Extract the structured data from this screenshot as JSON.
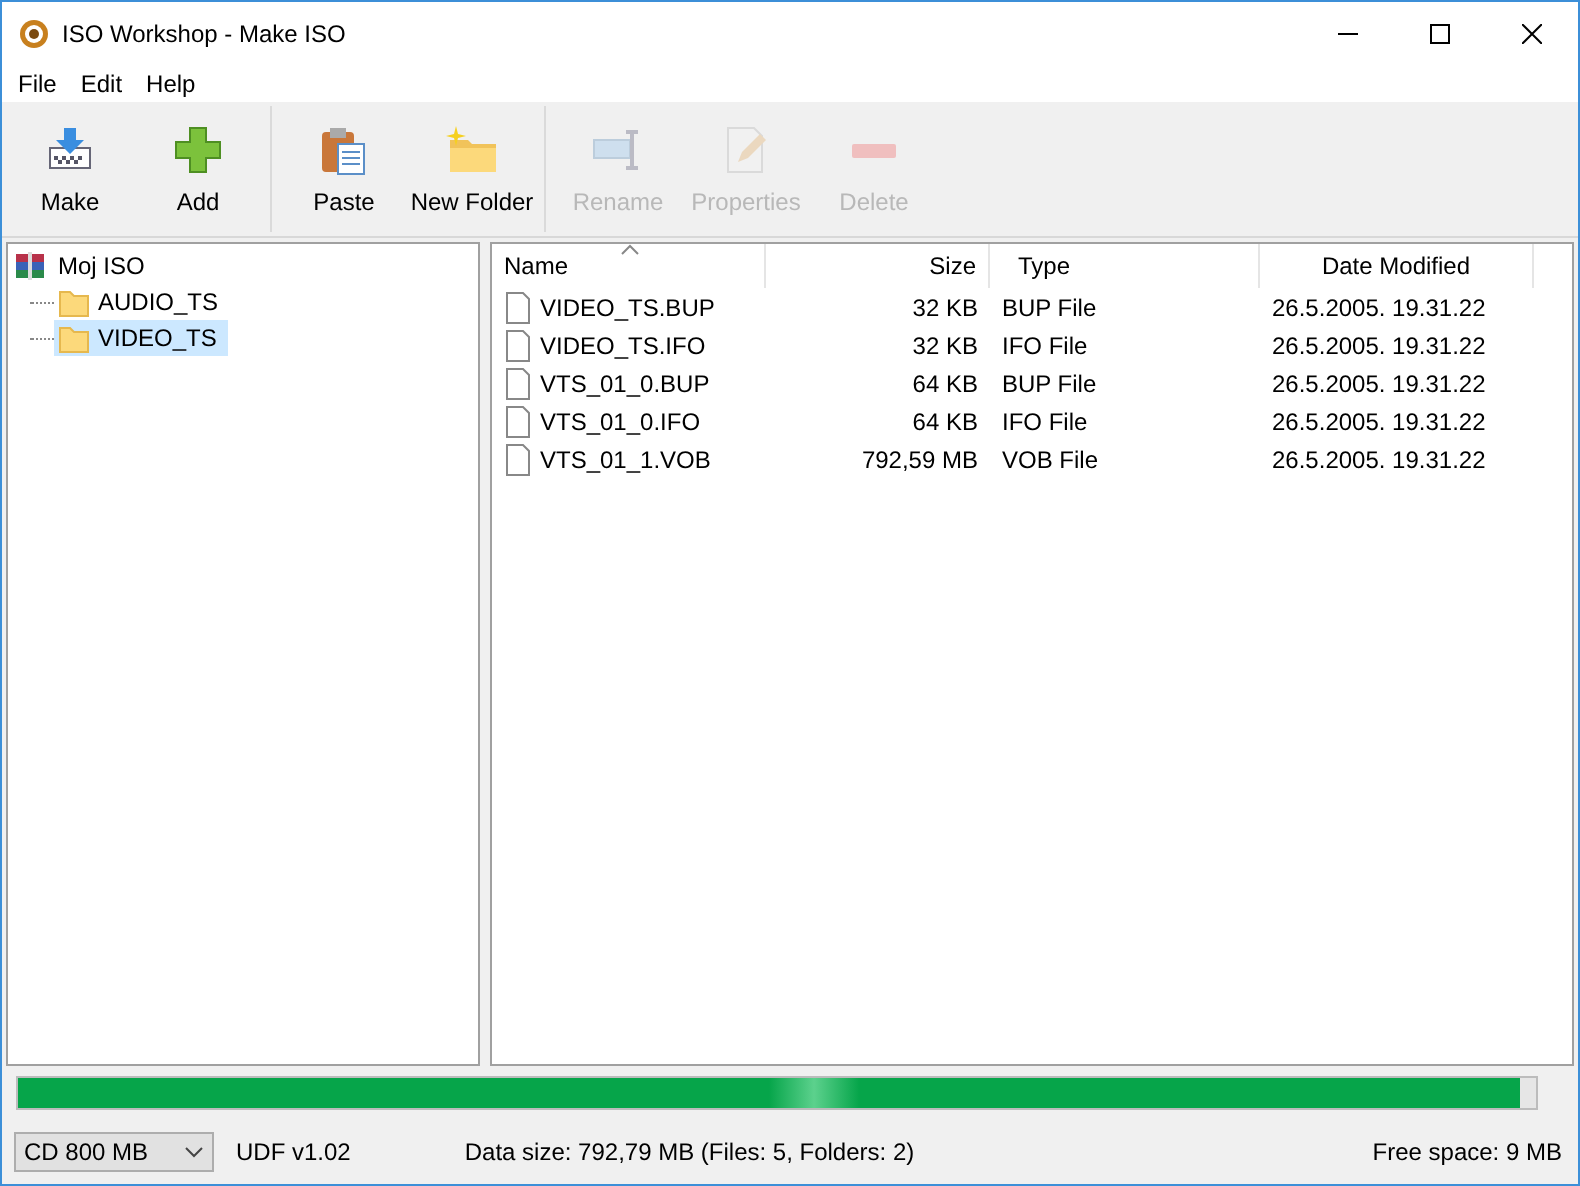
{
  "window": {
    "title": "ISO Workshop - Make ISO"
  },
  "menu": [
    "File",
    "Edit",
    "Help"
  ],
  "toolbar": [
    {
      "label": "Make",
      "kind": "make",
      "disabled": false
    },
    {
      "label": "Add",
      "kind": "add",
      "disabled": false
    },
    {
      "label": "Paste",
      "kind": "paste",
      "disabled": false
    },
    {
      "label": "New Folder",
      "kind": "folder",
      "disabled": false
    },
    {
      "label": "Rename",
      "kind": "rename",
      "disabled": true
    },
    {
      "label": "Properties",
      "kind": "properties",
      "disabled": true
    },
    {
      "label": "Delete",
      "kind": "delete",
      "disabled": true
    }
  ],
  "tree": {
    "label": "Moj ISO",
    "selected": false,
    "children": [
      {
        "label": "AUDIO_TS",
        "selected": false
      },
      {
        "label": "VIDEO_TS",
        "selected": true
      }
    ]
  },
  "table": {
    "columns": [
      {
        "label": "Name",
        "sorted": true
      },
      {
        "label": "Size",
        "sorted": false
      },
      {
        "label": "Type",
        "sorted": false
      },
      {
        "label": "Date Modified",
        "sorted": false
      }
    ],
    "rows": [
      [
        "VIDEO_TS.BUP",
        "32 KB",
        "BUP File",
        "26.5.2005. 19.31.22"
      ],
      [
        "VIDEO_TS.IFO",
        "32 KB",
        "IFO File",
        "26.5.2005. 19.31.22"
      ],
      [
        "VTS_01_0.BUP",
        "64 KB",
        "BUP File",
        "26.5.2005. 19.31.22"
      ],
      [
        "VTS_01_0.IFO",
        "64 KB",
        "IFO File",
        "26.5.2005. 19.31.22"
      ],
      [
        "VTS_01_1.VOB",
        "792,59 MB",
        "VOB File",
        "26.5.2005. 19.31.22"
      ]
    ]
  },
  "progress": {
    "level": 0.99
  },
  "status_bar": {
    "media": "CD 800 MB",
    "format": "UDF v1.02",
    "data_size": "Data size: 792,79 MB (Files: 5, Folders: 2)",
    "free_space": "Free space: 9 MB"
  }
}
